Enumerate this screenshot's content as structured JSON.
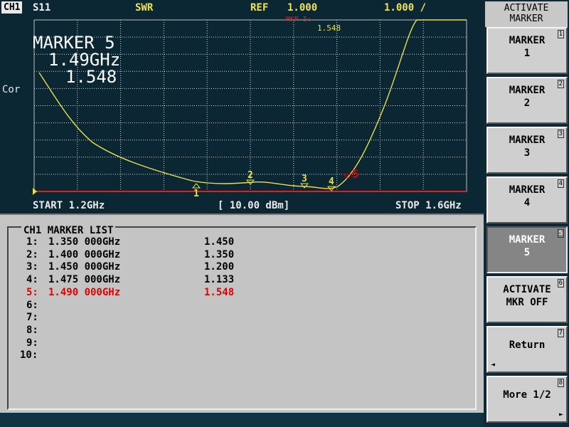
{
  "header": {
    "channel": "CH1",
    "param": "S11",
    "format": "SWR",
    "ref_label": "REF",
    "ref_value": "1.000",
    "scale": "1.000 /",
    "mkr_label": "MKR 5:",
    "mkr_value": "1.548"
  },
  "marker_readout": {
    "title": "MARKER 5",
    "freq": "1.49GHz",
    "value": "1.548"
  },
  "side_label": "Cor",
  "footer": {
    "start": "START 1.2GHz",
    "power": "[ 10.00 dBm]",
    "stop": "STOP 1.6GHz"
  },
  "marker_list": {
    "title": "CH1 MARKER LIST",
    "rows": [
      {
        "idx": "1:",
        "freq": "1.350 000GHz",
        "value": "1.450"
      },
      {
        "idx": "2:",
        "freq": "1.400 000GHz",
        "value": "1.350"
      },
      {
        "idx": "3:",
        "freq": "1.450 000GHz",
        "value": "1.200"
      },
      {
        "idx": "4:",
        "freq": "1.475 000GHz",
        "value": "1.133"
      },
      {
        "idx": "5:",
        "freq": "1.490 000GHz",
        "value": "1.548"
      },
      {
        "idx": "6:",
        "freq": "",
        "value": ""
      },
      {
        "idx": "7:",
        "freq": "",
        "value": ""
      },
      {
        "idx": "8:",
        "freq": "",
        "value": ""
      },
      {
        "idx": "9:",
        "freq": "",
        "value": ""
      },
      {
        "idx": "10:",
        "freq": "",
        "value": ""
      }
    ],
    "active_index": 4
  },
  "softkeys": {
    "title": "ACTIVATE\nMARKER",
    "keys": [
      {
        "label": "MARKER\n1",
        "num": "1"
      },
      {
        "label": "MARKER\n2",
        "num": "2"
      },
      {
        "label": "MARKER\n3",
        "num": "3"
      },
      {
        "label": "MARKER\n4",
        "num": "4"
      },
      {
        "label": "MARKER\n5",
        "num": "5"
      },
      {
        "label": "ACTIVATE\nMKR OFF",
        "num": "6"
      },
      {
        "label": "Return",
        "num": "7"
      },
      {
        "label": "More 1/2",
        "num": "8"
      }
    ],
    "selected": 4
  },
  "trace_markers": [
    {
      "label": "1",
      "freq_ghz": 1.35
    },
    {
      "label": "2",
      "freq_ghz": 1.4
    },
    {
      "label": "3",
      "freq_ghz": 1.45
    },
    {
      "label": "4",
      "freq_ghz": 1.475
    },
    {
      "label": "5",
      "freq_ghz": 1.49
    }
  ],
  "colors": {
    "trace": "#e8e04a",
    "grid": "#d8d8d8",
    "reference_line": "#e02020",
    "active_marker": "#e60000",
    "screen_bg": "#0a2733"
  }
}
